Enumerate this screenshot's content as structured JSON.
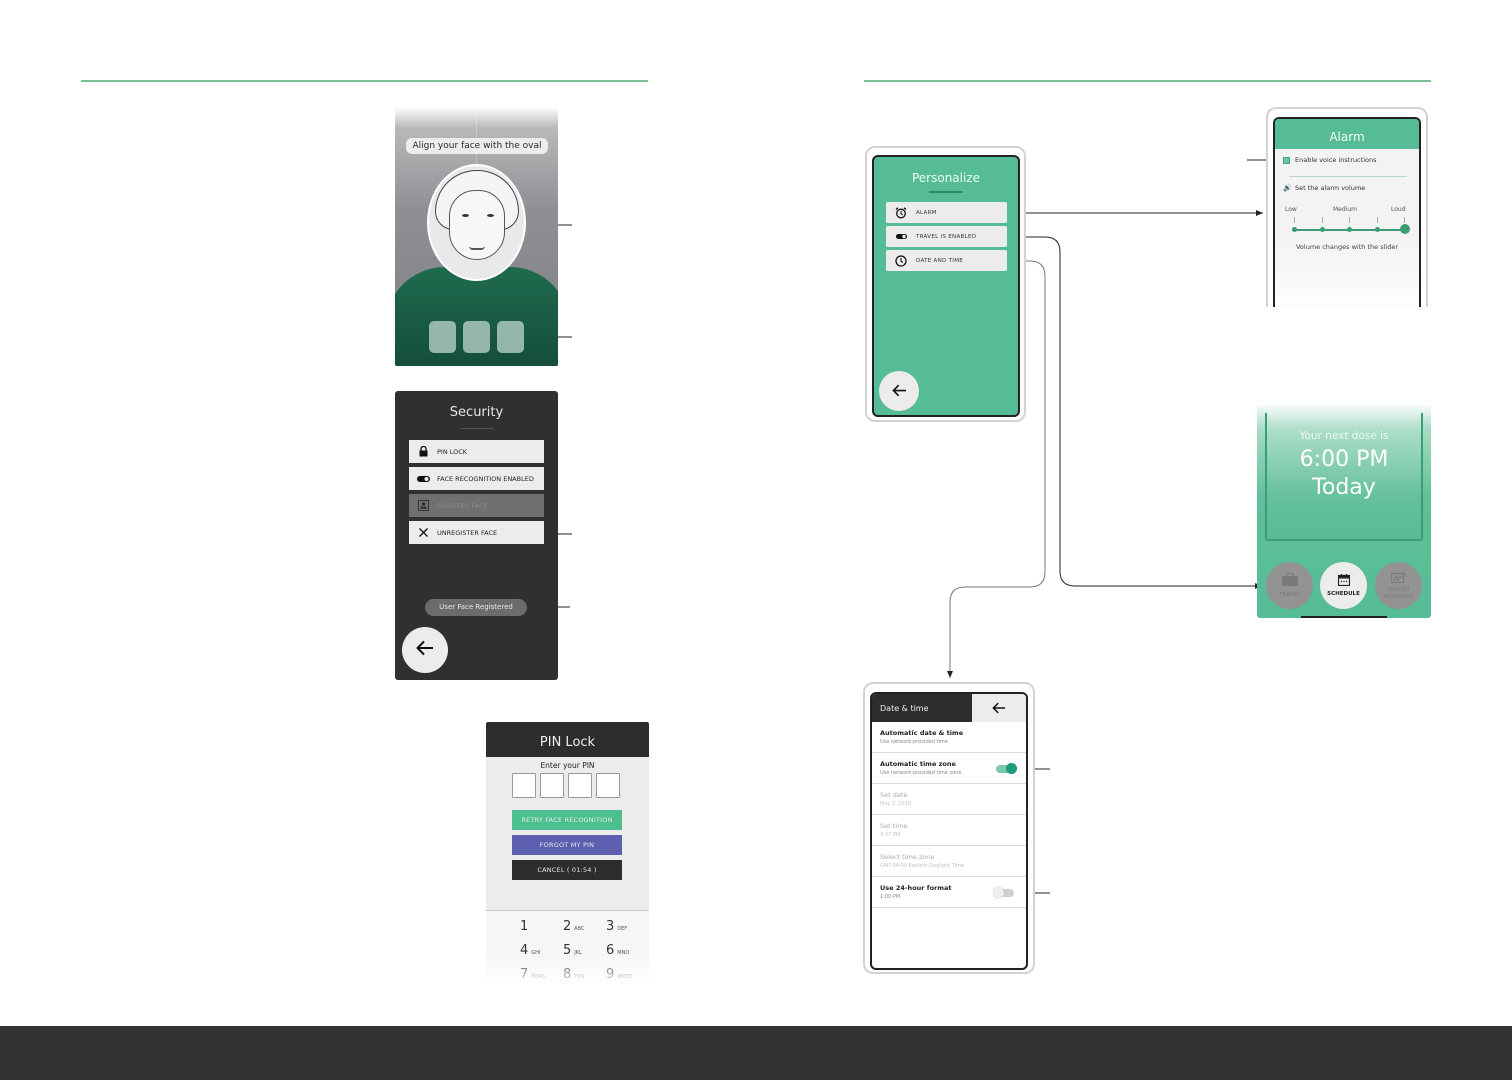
{
  "face_screen": {
    "banner": "Align your face with the oval",
    "slots": 3
  },
  "security_screen": {
    "title": "Security",
    "items": [
      {
        "label": "PIN LOCK",
        "icon": "lock-icon",
        "enabled": true
      },
      {
        "label": "FACE RECOGNITION ENABLED",
        "icon": "toggle-icon",
        "enabled": true
      },
      {
        "label": "REGISTER FACE",
        "icon": "portrait-icon",
        "enabled": false
      },
      {
        "label": "UNREGISTER FACE",
        "icon": "close-icon",
        "enabled": true
      }
    ],
    "status_badge": "User Face Registered",
    "back_icon": "arrow-left-icon"
  },
  "pin_screen": {
    "title": "PIN Lock",
    "prompt": "Enter your PIN",
    "digit_boxes": 4,
    "buttons": {
      "retry": "RETRY FACE RECOGNITION",
      "forgot": "FORGOT MY PIN",
      "cancel": "CANCEL ( 01:54 )"
    },
    "colors": {
      "retry": "#4cbf8f",
      "forgot": "#5d5fb0",
      "cancel": "#2d2d30"
    },
    "keypad": [
      {
        "digit": "1",
        "letters": ""
      },
      {
        "digit": "2",
        "letters": "ABC"
      },
      {
        "digit": "3",
        "letters": "DEF"
      },
      {
        "digit": "4",
        "letters": "GHI"
      },
      {
        "digit": "5",
        "letters": "JKL"
      },
      {
        "digit": "6",
        "letters": "MNO"
      },
      {
        "digit": "7",
        "letters": "PQRS"
      },
      {
        "digit": "8",
        "letters": "TUV"
      },
      {
        "digit": "9",
        "letters": "WXYZ"
      }
    ]
  },
  "personalize_screen": {
    "title": "Personalize",
    "items": [
      {
        "label": "ALARM",
        "icon": "alarm-clock-icon"
      },
      {
        "label": "TRAVEL IS ENABLED",
        "icon": "toggle-icon"
      },
      {
        "label": "DATE AND TIME",
        "icon": "clock-icon"
      }
    ],
    "back_icon": "arrow-left-icon"
  },
  "alarm_screen": {
    "title": "Alarm",
    "voice_instructions": {
      "label": "Enable voice instructions",
      "checked": true
    },
    "volume_label": "Set the alarm volume",
    "scale_labels": [
      "Low",
      "Medium",
      "Loud"
    ],
    "volume_steps": 5,
    "volume_level": 5,
    "caption": "Volume changes with the slider"
  },
  "dose_screen": {
    "label": "Your next dose is",
    "time": "6:00 PM",
    "day": "Today",
    "nav": [
      {
        "label": "TRAVEL",
        "icon": "briefcase-icon",
        "active": false
      },
      {
        "label": "SCHEDULE",
        "icon": "calendar-icon",
        "active": true
      },
      {
        "label": "HEALTH MONITORS",
        "icon": "health-monitor-icon",
        "active": false
      }
    ]
  },
  "datetime_screen": {
    "title": "Date & time",
    "rows": [
      {
        "title": "Automatic date & time",
        "subtitle": "Use network-provided time",
        "enabled": true,
        "toggle": null
      },
      {
        "title": "Automatic time zone",
        "subtitle": "Use network-provided time zone",
        "enabled": true,
        "toggle": "on"
      },
      {
        "title": "Set date",
        "subtitle": "May 2, 2018",
        "enabled": false,
        "toggle": null
      },
      {
        "title": "Set time",
        "subtitle": "3:07 PM",
        "enabled": false,
        "toggle": null
      },
      {
        "title": "Select time zone",
        "subtitle": "GMT-04:00 Eastern Daylight Time",
        "enabled": false,
        "toggle": null
      },
      {
        "title": "Use 24-hour format",
        "subtitle": "1:00 PM",
        "enabled": true,
        "toggle": "off"
      }
    ]
  },
  "theme": {
    "accent_green": "#55bc95",
    "rule_green": "#7cc095",
    "dark": "#303033",
    "footer": "#323234"
  }
}
